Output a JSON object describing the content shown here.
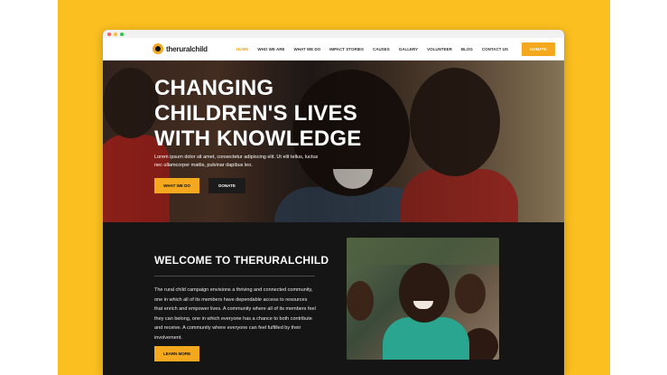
{
  "colors": {
    "accent": "#f4a81d",
    "background": "#fbbf1f",
    "dark": "#151515",
    "window_dot_red": "#ff5f57",
    "window_dot_yellow": "#febc2e",
    "window_dot_green": "#28c840"
  },
  "logo": {
    "text": "theruralchild",
    "icon": "child-circle-logo-icon"
  },
  "nav": {
    "items": [
      {
        "label": "HOME",
        "active": true
      },
      {
        "label": "WHO WE ARE",
        "active": false
      },
      {
        "label": "WHAT WE DO",
        "active": false
      },
      {
        "label": "IMPACT STORIES",
        "active": false
      },
      {
        "label": "CAUSES",
        "active": false
      },
      {
        "label": "GALLERY",
        "active": false
      },
      {
        "label": "VOLUNTEER",
        "active": false
      },
      {
        "label": "BLOG",
        "active": false
      },
      {
        "label": "CONTACT US",
        "active": false
      }
    ],
    "donate_label": "DONATE"
  },
  "hero": {
    "title": "CHANGING\nCHILDREN'S LIVES\nWITH KNOWLEDGE",
    "text": "Lorem ipsum dolor sit amet, consectetur adipiscing elit. Ut elit tellus, luctus nec ullamcorper mattis, pulvinar dapibus leo.",
    "primary_button": "WHAT WE DO",
    "secondary_button": "DONATE"
  },
  "welcome": {
    "title": "WELCOME TO THERURALCHILD",
    "text": "The rural child campaign envisions a thriving and connected community, one in which all of its members have dependable access to resources that enrich and empower lives. A community where all of its members feel they can belong, one in which everyone has a chance to both contribute and receive. A community where everyone can feel fulfilled by their involvement.",
    "button": "LEARN MORE"
  }
}
